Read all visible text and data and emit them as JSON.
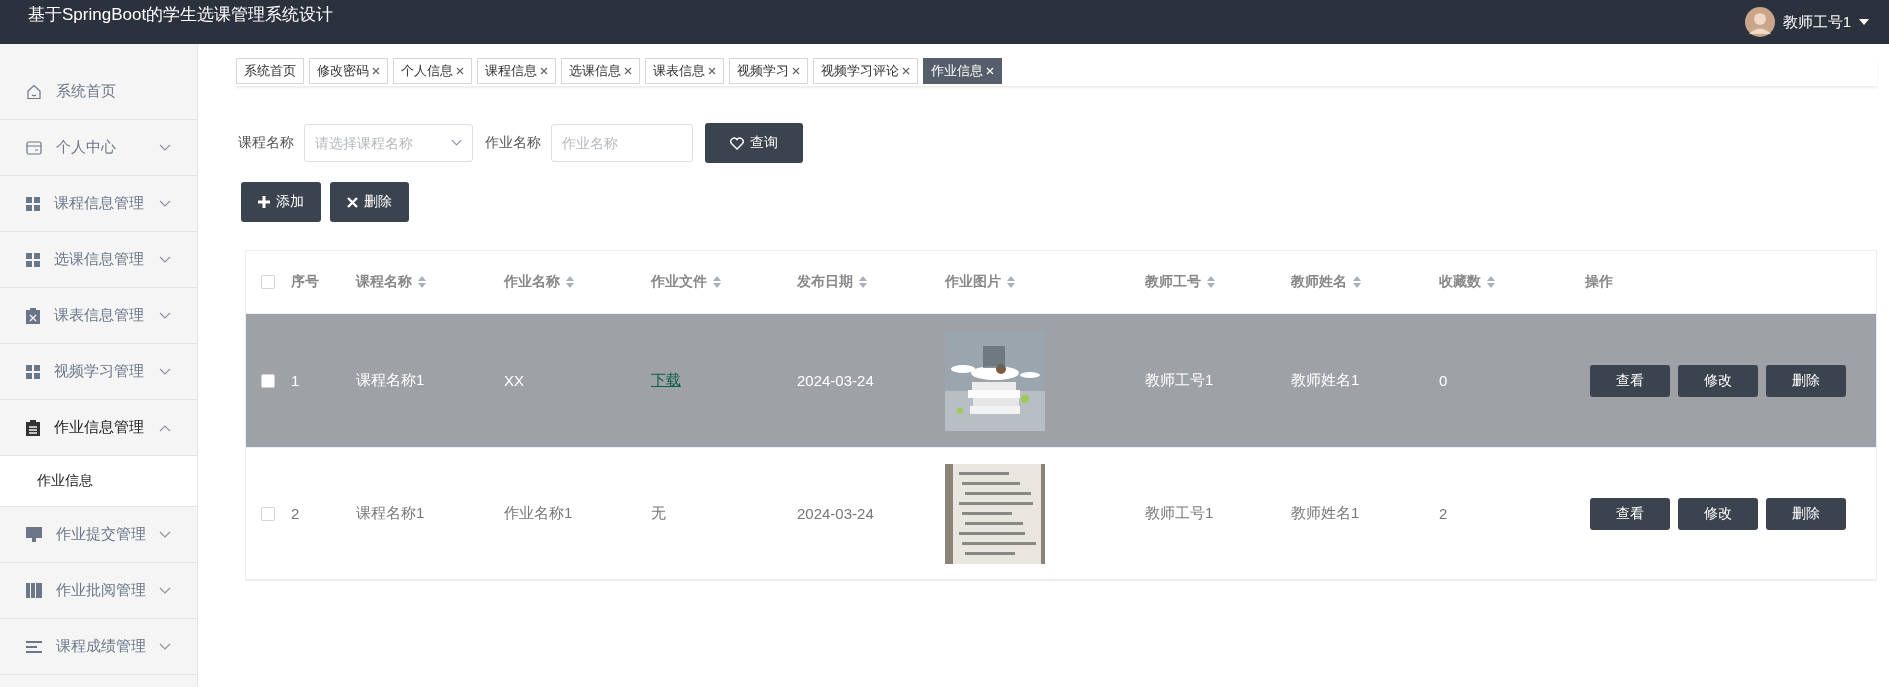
{
  "header": {
    "title": "基于SpringBoot的学生选课管理系统设计",
    "user": {
      "name": "教师工号1"
    }
  },
  "sidebar": {
    "items": [
      {
        "label": "系统首页",
        "kind": "link",
        "expanded": false
      },
      {
        "label": "个人中心",
        "kind": "menu",
        "expanded": false
      },
      {
        "label": "课程信息管理",
        "kind": "menu",
        "expanded": false
      },
      {
        "label": "选课信息管理",
        "kind": "menu",
        "expanded": false
      },
      {
        "label": "课表信息管理",
        "kind": "menu",
        "expanded": false
      },
      {
        "label": "视频学习管理",
        "kind": "menu",
        "expanded": false
      },
      {
        "label": "作业信息管理",
        "kind": "menu",
        "expanded": true,
        "children": [
          {
            "label": "作业信息",
            "selected": true
          }
        ]
      },
      {
        "label": "作业提交管理",
        "kind": "menu",
        "expanded": false
      },
      {
        "label": "作业批阅管理",
        "kind": "menu",
        "expanded": false
      },
      {
        "label": "课程成绩管理",
        "kind": "menu",
        "expanded": false
      }
    ]
  },
  "tabs": [
    {
      "label": "系统首页",
      "closable": false,
      "selected": false
    },
    {
      "label": "修改密码",
      "closable": true,
      "selected": false
    },
    {
      "label": "个人信息",
      "closable": true,
      "selected": false
    },
    {
      "label": "课程信息",
      "closable": true,
      "selected": false
    },
    {
      "label": "选课信息",
      "closable": true,
      "selected": false
    },
    {
      "label": "课表信息",
      "closable": true,
      "selected": false
    },
    {
      "label": "视频学习",
      "closable": true,
      "selected": false
    },
    {
      "label": "视频学习评论",
      "closable": true,
      "selected": false
    },
    {
      "label": "作业信息",
      "closable": true,
      "selected": true
    }
  ],
  "search": {
    "fields": [
      {
        "label": "课程名称",
        "placeholder": "请选择课程名称",
        "kind": "select"
      },
      {
        "label": "作业名称",
        "placeholder": "作业名称",
        "kind": "text"
      }
    ],
    "button": "查询"
  },
  "actions": [
    {
      "label": "添加",
      "kind": "add"
    },
    {
      "label": "删除",
      "kind": "delete"
    }
  ],
  "table": {
    "select_all_checked": false,
    "columns": [
      {
        "label": "序号",
        "sortable": false
      },
      {
        "label": "课程名称",
        "sortable": true
      },
      {
        "label": "作业名称",
        "sortable": true
      },
      {
        "label": "作业文件",
        "sortable": true
      },
      {
        "label": "发布日期",
        "sortable": true
      },
      {
        "label": "作业图片",
        "sortable": true
      },
      {
        "label": "教师工号",
        "sortable": true
      },
      {
        "label": "教师姓名",
        "sortable": true
      },
      {
        "label": "收藏数",
        "sortable": true
      },
      {
        "label": "操作",
        "sortable": false
      }
    ],
    "rows": [
      {
        "checked": false,
        "highlighted": true,
        "index": "1",
        "course": "课程名称1",
        "name": "XX",
        "file": "下载",
        "file_link": true,
        "date": "2024-03-24",
        "teacher_id": "教师工号1",
        "teacher_name": "教师姓名1",
        "favorites": "0",
        "buttons": [
          "查看",
          "修改",
          "删除"
        ]
      },
      {
        "checked": false,
        "highlighted": false,
        "index": "2",
        "course": "课程名称1",
        "name": "作业名称1",
        "file": "无",
        "file_link": false,
        "date": "2024-03-24",
        "teacher_id": "教师工号1",
        "teacher_name": "教师姓名1",
        "favorites": "2",
        "buttons": [
          "查看",
          "修改",
          "删除"
        ]
      }
    ]
  }
}
